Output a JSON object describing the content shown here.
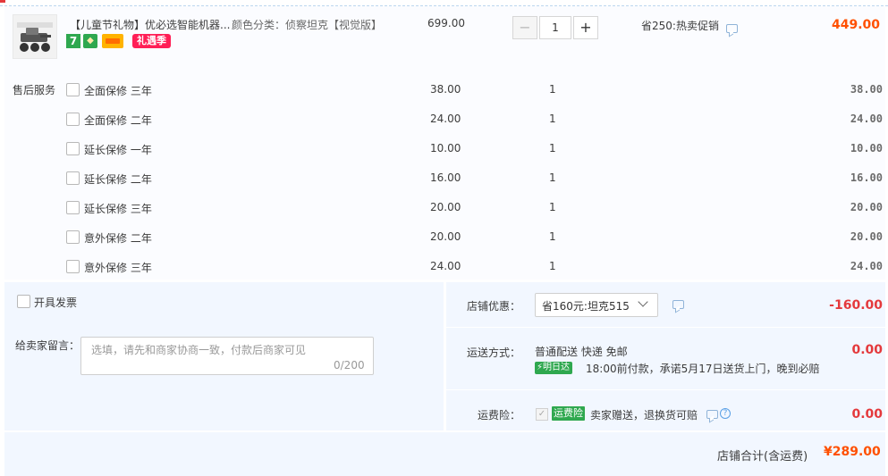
{
  "item": {
    "title": "【儿童节礼物】优必选智能机器...",
    "sku_label": "颜色分类：侦察坦克【视觉版】",
    "badge_seven": "7",
    "gift_tag": "礼遇季",
    "price": "699.00",
    "quantity": "1",
    "promo": "省250:热卖促销",
    "subtotal": "449.00"
  },
  "services": {
    "label": "售后服务",
    "rows": [
      {
        "name": "全面保修 三年",
        "price": "38.00",
        "qty": "1",
        "total": "38.00"
      },
      {
        "name": "全面保修 二年",
        "price": "24.00",
        "qty": "1",
        "total": "24.00"
      },
      {
        "name": "延长保修 一年",
        "price": "10.00",
        "qty": "1",
        "total": "10.00"
      },
      {
        "name": "延长保修 二年",
        "price": "16.00",
        "qty": "1",
        "total": "16.00"
      },
      {
        "name": "延长保修 三年",
        "price": "20.00",
        "qty": "1",
        "total": "20.00"
      },
      {
        "name": "意外保修 二年",
        "price": "20.00",
        "qty": "1",
        "total": "20.00"
      },
      {
        "name": "意外保修 三年",
        "price": "24.00",
        "qty": "1",
        "total": "24.00"
      }
    ]
  },
  "invoice": {
    "label": "开具发票"
  },
  "message": {
    "label": "给卖家留言：",
    "placeholder": "选填，请先和商家协商一致，付款后商家可见",
    "count": "0/200"
  },
  "shop_discount": {
    "label": "店铺优惠：",
    "selected": "省160元:坦克515",
    "amount": "-160.00"
  },
  "shipping": {
    "label": "运送方式：",
    "method": "普通配送 快递 免邮",
    "tomorrow_badge": "明日达",
    "note": "18:00前付款，承诺5月17日送货上门，晚到必赔",
    "amount": "0.00"
  },
  "insurance": {
    "label": "运费险：",
    "badge": "运费险",
    "text": "卖家赠送，退换货可赔",
    "amount": "0.00"
  },
  "total": {
    "label": "店铺合计(含运费)",
    "value": "¥289.00"
  },
  "colors": {
    "accent_orange": "#ff5000",
    "discount_red": "#e4393c",
    "panel_blue": "#f2f7ff",
    "badge_green": "#2fa84f",
    "gift_pink": "#ff1f56"
  }
}
